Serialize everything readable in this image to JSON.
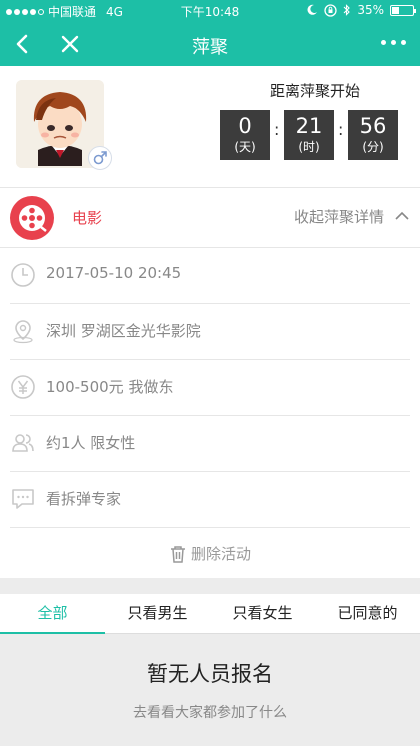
{
  "status_bar": {
    "carrier": "中国联通",
    "network": "4G",
    "time": "下午10:48",
    "battery": "35%",
    "battery_level": 0.35
  },
  "nav": {
    "title": "萍聚",
    "back_icon": "chevron-left-icon",
    "close_icon": "close-icon",
    "more_icon": "more-dots-icon"
  },
  "header": {
    "countdown_title": "距离萍聚开始",
    "countdown": [
      {
        "value": "0",
        "unit": "(天)"
      },
      {
        "value": "21",
        "unit": "(时)"
      },
      {
        "value": "56",
        "unit": "(分)"
      }
    ],
    "gender_icon": "male-icon"
  },
  "event": {
    "category": "电影",
    "collapse_label": "收起萍聚详情",
    "accent_color": "#e8414d",
    "details": [
      {
        "icon": "clock-icon",
        "text": "2017-05-10 20:45"
      },
      {
        "icon": "location-icon",
        "text": "深圳 罗湖区金光华影院"
      },
      {
        "icon": "yuan-icon",
        "text": "100-500元 我做东"
      },
      {
        "icon": "people-icon",
        "text": "约1人 限女性"
      },
      {
        "icon": "message-icon",
        "text": "看拆弹专家"
      }
    ],
    "delete_label": "删除活动"
  },
  "tabs": {
    "items": [
      "全部",
      "只看男生",
      "只看女生",
      "已同意的"
    ],
    "active_index": 0,
    "active_color": "#1dbfa6"
  },
  "empty_state": {
    "title": "暂无人员报名",
    "subtitle": "去看看大家都参加了什么"
  }
}
